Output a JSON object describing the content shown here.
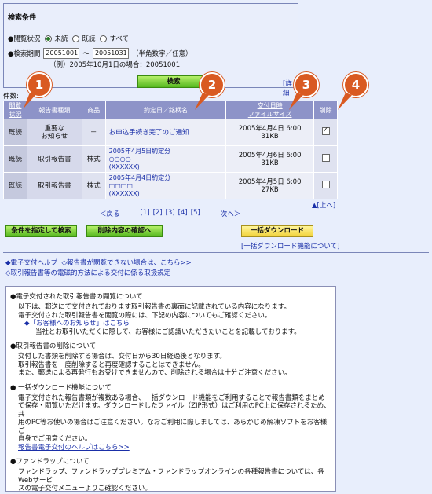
{
  "search": {
    "title": "検索条件",
    "status_label": "●閲覧状況",
    "options": [
      "未読",
      "既読",
      "すべて"
    ],
    "period_label": "●検索期間",
    "date_from": "20051001",
    "tilde": "～",
    "date_to": "20051031",
    "format_note": "（半角数字／任意）",
    "example": "（例）2005年10月1日の場合：20051001",
    "button": "検索",
    "detail_link": "[詳細"
  },
  "count_label": "件数:",
  "badges": [
    "1",
    "2",
    "3",
    "4"
  ],
  "table": {
    "headers": [
      "閲覧\n状況",
      "報告書種類",
      "商品",
      "約定日／銘柄名",
      "交付日時\nファイルサイズ",
      "削除"
    ],
    "rows": [
      {
        "status": "既読",
        "type": "重要な\nお知らせ",
        "product": "－",
        "name": "お申込手続き完了のご通知",
        "date": "2005年4月4日 6:00",
        "size": "31KB",
        "checked": true
      },
      {
        "status": "既読",
        "type": "取引報告書",
        "product": "株式",
        "name": "2005年4月5日約定分\n○○○○\n(XXXXXX)",
        "date": "2005年4月6日 6:00",
        "size": "31KB",
        "checked": false
      },
      {
        "status": "既読",
        "type": "取引報告書",
        "product": "株式",
        "name": "2005年4月4日約定分\n□□□□\n(XXXXXX)",
        "date": "2005年4月5日 6:00",
        "size": "27KB",
        "checked": false
      }
    ]
  },
  "pager": {
    "prev": "＜戻る",
    "pages": [
      "[1]",
      "[2]",
      "[3]",
      "[4]",
      "[5]"
    ],
    "next": "次へ＞"
  },
  "to_top": "▲[上へ]",
  "buttons": {
    "condition": "条件を指定して検索",
    "confirm": "削除内容の確認へ",
    "bulk": "一括ダウンロード"
  },
  "bulk_help": "[一括ダウンロード機能について]",
  "links": {
    "help": "◆電子交付ヘルプ",
    "cannot_view": "◇報告書が閲覧できない場合は、こちら>>",
    "rules": "◇取引報告書等の電磁的方法による交付に係る取扱規定"
  },
  "notes": [
    {
      "title": "●電子交付された取引報告書の閲覧について",
      "lines": [
        "以下は、郵送にて交付されております取引報告書の裏面に記載されている内容になります。",
        "電子交付された取引報告書を閲覧の際には、下記の内容についてもご確認ください。"
      ],
      "link": "◆「お客様へのお知らせ」はこちら",
      "link_note": "当社とお取引いただくに際して、お客様にご認識いただきたいことを記載しております。"
    },
    {
      "title": "●取引報告書の削除について",
      "lines": [
        "交付した書類を削除する場合は、交付日から30日経過後となります。",
        "取引報告書を一度削除すると再度確認することはできません。",
        "また、郵送による再発行もお受けできませんので、削除される場合は十分ご注意ください。"
      ]
    },
    {
      "title": "● 一括ダウンロード機能について",
      "lines": [
        "電子交付された報告書類が複数ある場合、一括ダウンロード機能をご利用することで報告書類をまとめ",
        "て保存・閲覧いただけます。ダウンロードしたファイル（ZIP形式）はご利用のPC上に保存されるため、共",
        "用のPC等お使いの場合はご注意ください。なおご利用に際しましては、あらかじめ解凍ソフトをお客様ご",
        "自身でご用意ください。"
      ],
      "link": "報告書電子交付のヘルプはこちら>>"
    },
    {
      "title": "●ファンドラップについて",
      "lines": [
        "ファンドラップ、ファンドラッププレミアム・ファンドラップオンラインの各種報告書については、各Webサービ",
        "スの電子交付メニューよりご確認ください。"
      ]
    }
  ],
  "colors": {
    "badge": "#d95a22",
    "header": "#8d93c8",
    "green_button": "#55b81f",
    "yellow_button": "#f2d23b",
    "background": "#e8eefc"
  }
}
